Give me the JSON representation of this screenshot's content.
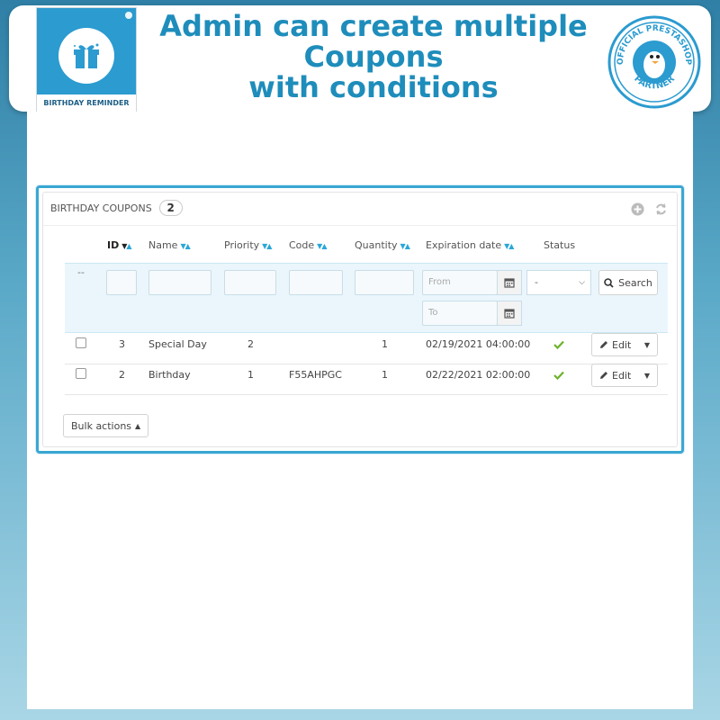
{
  "banner": {
    "logo_label": "BIRTHDAY REMINDER",
    "headline_lines": [
      "Admin can create multiple",
      "Coupons",
      "with conditions"
    ],
    "partner_text": [
      "OFFICIAL PRESTASHOP",
      "PARTNER"
    ]
  },
  "panel": {
    "title": "BIRTHDAY COUPONS",
    "count": "2",
    "columns": {
      "id": "ID",
      "name": "Name",
      "priority": "Priority",
      "code": "Code",
      "quantity": "Quantity",
      "expiration": "Expiration date",
      "status": "Status"
    },
    "filters": {
      "bulk_placeholder": "--",
      "from_placeholder": "From",
      "to_placeholder": "To",
      "status_selected": "-",
      "search_label": "Search"
    },
    "rows": [
      {
        "id": "3",
        "name": "Special Day",
        "priority": "2",
        "code": "",
        "quantity": "1",
        "expiration": "02/19/2021 04:00:00",
        "edit": "Edit"
      },
      {
        "id": "2",
        "name": "Birthday",
        "priority": "1",
        "code": "F55AHPGC",
        "quantity": "1",
        "expiration": "02/22/2021 02:00:00",
        "edit": "Edit"
      }
    ],
    "bulk_actions": "Bulk actions"
  },
  "colors": {
    "accent": "#2aa7d8",
    "headline": "#1e8dbb",
    "status_ok": "#6cb22b"
  },
  "icons": [
    "gift-icon",
    "add-icon",
    "refresh-icon",
    "calendar-icon",
    "search-icon",
    "pencil-icon",
    "check-icon"
  ]
}
